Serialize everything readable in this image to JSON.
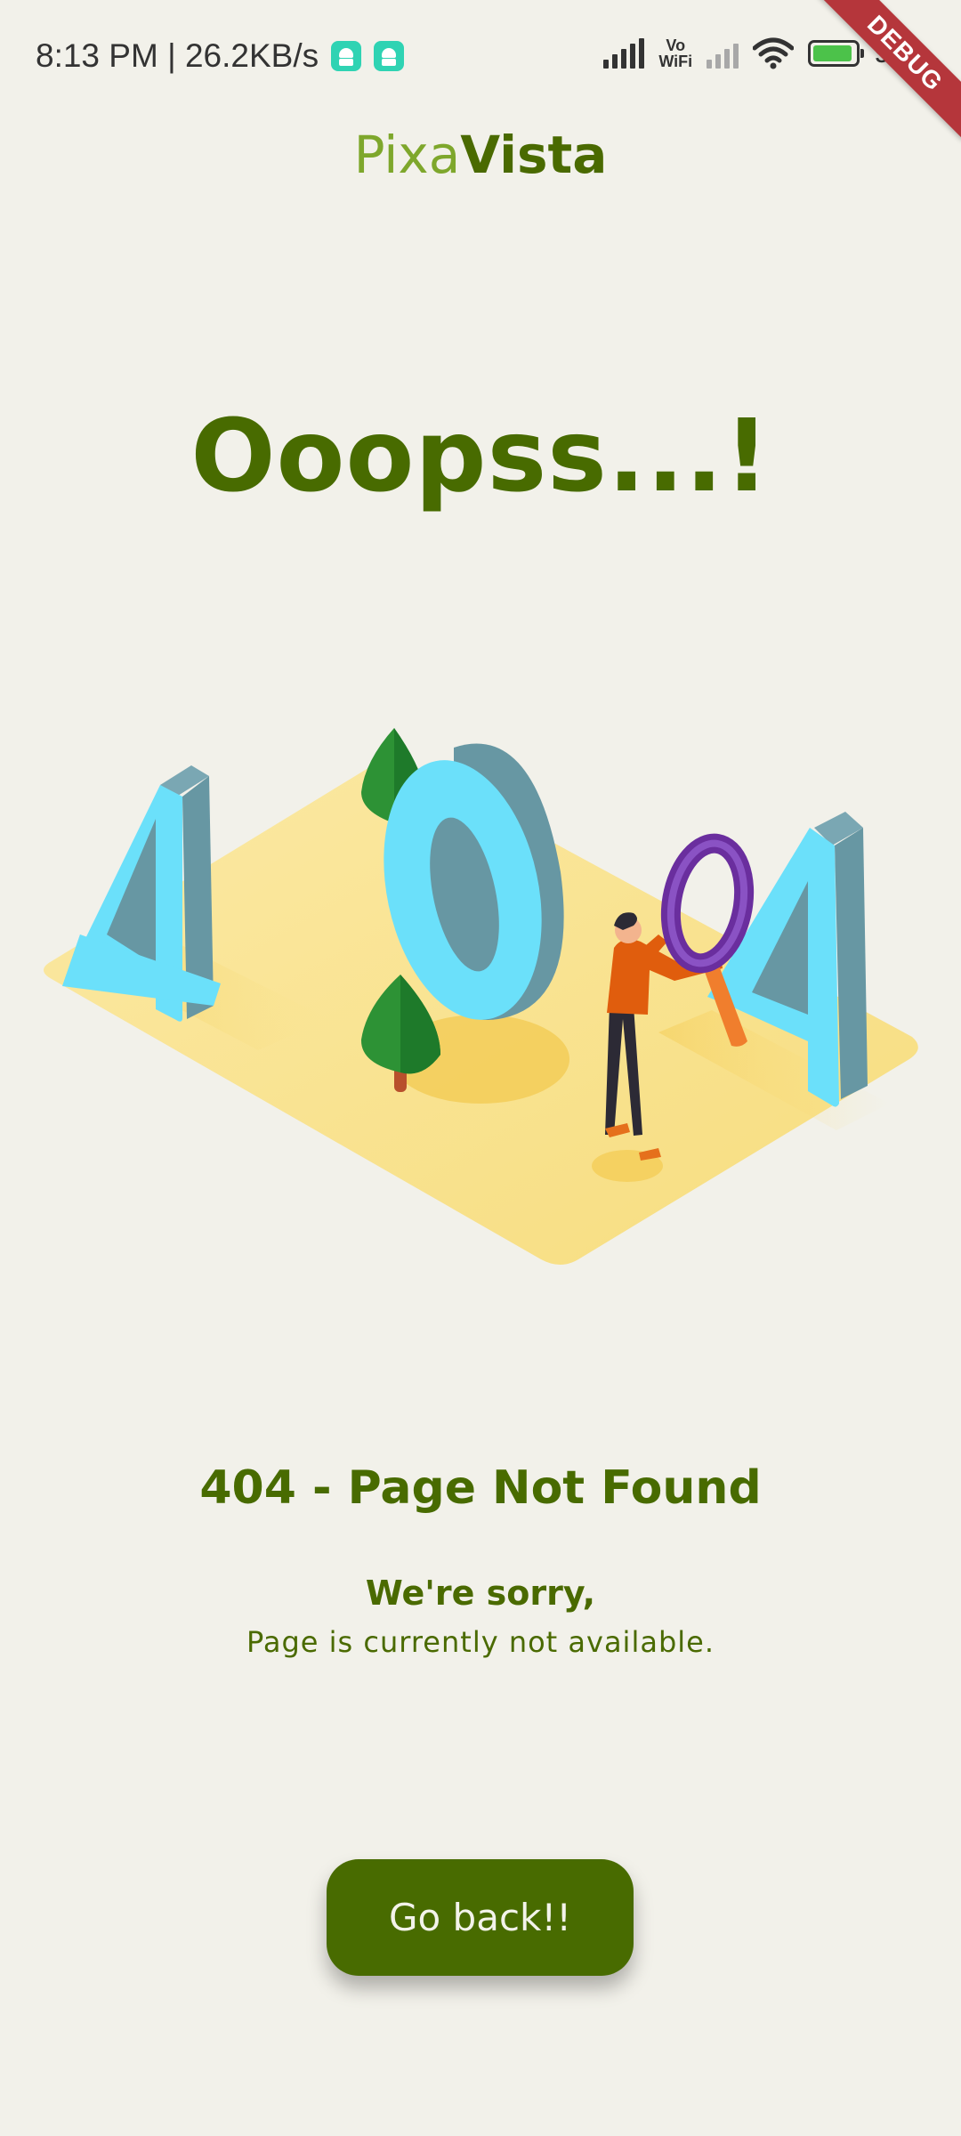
{
  "status_bar": {
    "time_speed": "8:13 PM | 26.2KB/s",
    "vo_wifi_top": "Vo",
    "vo_wifi_bottom": "WiFi",
    "battery": "95",
    "icons": [
      "android-app-icon",
      "android-app-icon",
      "signal-icon",
      "vowifi-icon",
      "signal-no-service-icon",
      "wifi-icon",
      "battery-charging-icon"
    ]
  },
  "debug_ribbon": "DEBUG",
  "logo": {
    "light": "Pixa",
    "bold": "Vista"
  },
  "headline": "Ooopss...!",
  "illustration": {
    "icon": "404-illustration",
    "digits": [
      "4",
      "0",
      "4"
    ],
    "colors": {
      "ground": "#f9e38d",
      "digit_face": "#6be0fa",
      "digit_side": "#6797a3",
      "tree": "#2d9235",
      "person_shirt": "#e05d0d",
      "magnifier": "#6a2e9e"
    }
  },
  "message": {
    "title": "404 - Page Not Found",
    "sorry": "We're sorry,",
    "detail": "Page is currently not available."
  },
  "button": {
    "label": "Go back!!"
  },
  "colors": {
    "background": "#f2f1ea",
    "primary": "#486b00",
    "accent_light": "#7ea72c"
  }
}
